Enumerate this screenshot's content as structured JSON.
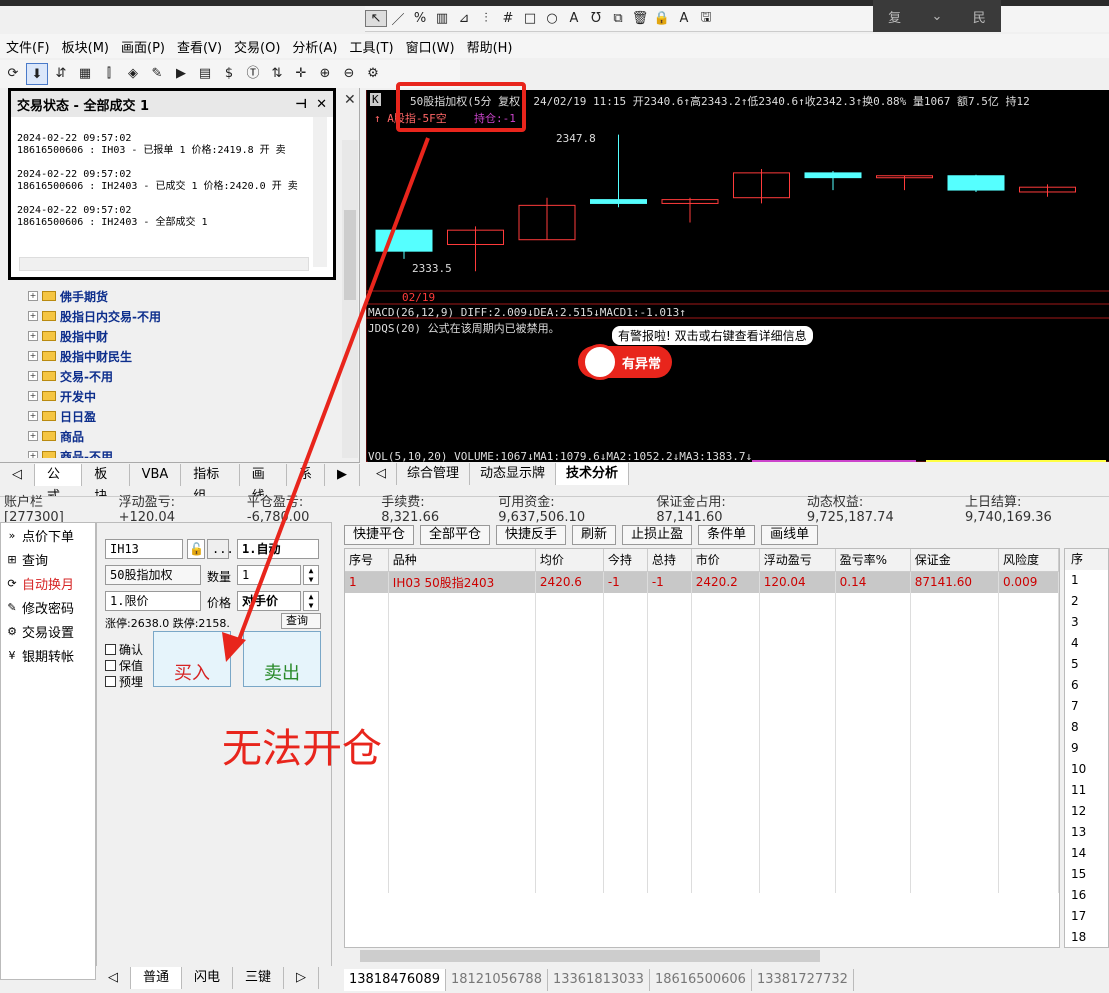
{
  "window": {
    "drawing_tools": [
      "↖",
      "／",
      "%",
      "▥",
      "⊿",
      "⫶",
      "#",
      "□",
      "○",
      "A",
      "Ʊ",
      "⧉",
      "🗑",
      "🔒",
      "A",
      "🖫"
    ],
    "dark_tab": [
      "复",
      "民"
    ]
  },
  "menu": [
    "文件(F)",
    "板块(M)",
    "画面(P)",
    "查看(V)",
    "交易(O)",
    "分析(A)",
    "工具(T)",
    "窗口(W)",
    "帮助(H)"
  ],
  "toolbar": [
    "⟳",
    "⬇",
    "⇵",
    "▦",
    "⫿",
    "◈",
    "✎",
    "▶",
    "▤",
    "$",
    "Ⓣ",
    "⇅",
    "✛",
    "⊕",
    "⊖",
    "⚙"
  ],
  "trade_popup": {
    "title": "交易状态 - 全部成交 1",
    "pin": "⊣",
    "close": "✕",
    "log": "\n2024-02-22 09:57:02\n18616500606 : IH03 - 已报单 1 价格:2419.8 开 卖\n\n2024-02-22 09:57:02\n18616500606 : IH2403 - 已成交 1 价格:2420.0 开 卖\n\n2024-02-22 09:57:02\n18616500606 : IH2403 - 全部成交 1"
  },
  "tree": [
    "佛手期货",
    "股指日内交易-不用",
    "股指中财",
    "股指中财民生",
    "交易-不用",
    "开发中",
    "日日盈",
    "商品",
    "商品-不用"
  ],
  "left_tabs": [
    "公式",
    "板块",
    "VBA",
    "指标组",
    "画线",
    "系"
  ],
  "chart": {
    "header_k": "K",
    "header": "50股指加权(5分 复权) 24/02/19 11:15 开2340.6↑高2343.2↑低2340.6↑收2342.3↑换0.88% 量1067 额7.5亿 持12",
    "subheader_a": "↑ A股指-5F空",
    "subheader_b": "持仓:-1",
    "high_label": "2347.8",
    "low_label": "2333.5",
    "date_label": "02/19",
    "macd": "MACD(26,12,9) DIFF:2.009↓DEA:2.515↓MACD1:-1.013↑",
    "jdqs": "JDQS(20)   公式在该周期内已被禁用。",
    "alert_text": "有警报啦! 双击或右键查看详细信息",
    "alert_badge": "有异常",
    "vol": "VOL(5,10,20) VOLUME:1067↓MA1:1079.6↓MA2:1052.2↓MA3:1383.7↓",
    "colors": {
      "up": "#ff3b3b",
      "down": "#55ffff",
      "bg": "#000000",
      "annot": "#e8251c"
    },
    "candles": [
      {
        "o": 2337.8,
        "h": 2337.8,
        "l": 2334.8,
        "c": 2335.6,
        "dir": "down"
      },
      {
        "o": 2336.3,
        "h": 2338.2,
        "l": 2333.5,
        "c": 2337.8,
        "dir": "up"
      },
      {
        "o": 2336.8,
        "h": 2341.2,
        "l": 2336.8,
        "c": 2340.4,
        "dir": "up"
      },
      {
        "o": 2341.0,
        "h": 2347.8,
        "l": 2340.2,
        "c": 2340.6,
        "dir": "down"
      },
      {
        "o": 2340.6,
        "h": 2341.2,
        "l": 2338.6,
        "c": 2341.0,
        "dir": "up"
      },
      {
        "o": 2341.2,
        "h": 2344.2,
        "l": 2340.6,
        "c": 2343.8,
        "dir": "up"
      },
      {
        "o": 2343.8,
        "h": 2344.0,
        "l": 2342.0,
        "c": 2343.3,
        "dir": "down"
      },
      {
        "o": 2343.5,
        "h": 2343.5,
        "l": 2342.0,
        "c": 2343.5,
        "dir": "up"
      },
      {
        "o": 2343.5,
        "h": 2343.6,
        "l": 2341.8,
        "c": 2342.0,
        "dir": "down"
      },
      {
        "o": 2341.8,
        "h": 2342.6,
        "l": 2341.3,
        "c": 2342.3,
        "dir": "up"
      }
    ],
    "ylim": [
      2333.0,
      2348.5
    ]
  },
  "chart_tabs": [
    "综合管理",
    "动态显示牌",
    "技术分析"
  ],
  "account_bar": [
    "账户栏 [277300]",
    "浮动盈亏: +120.04",
    "平仓盈亏: -6,780.00",
    "手续费: 8,321.66",
    "可用资金: 9,637,506.10",
    "保证金占用: 87,141.60",
    "动态权益: 9,725,187.74",
    "上日结算: 9,740,169.36"
  ],
  "order_menu": [
    {
      "icon": "»",
      "label": "点价下单"
    },
    {
      "icon": "⊞",
      "label": "查询"
    },
    {
      "icon": "⟳",
      "label": "自动换月"
    },
    {
      "icon": "✎",
      "label": "修改密码"
    },
    {
      "icon": "⚙",
      "label": "交易设置"
    },
    {
      "icon": "¥",
      "label": "银期转帐"
    }
  ],
  "order_form": {
    "code": "IH13",
    "lock": "🔓",
    "more": "...",
    "auto": "1.自动",
    "name": "50股指加权",
    "qty_label": "数量",
    "qty": "1",
    "price_type": "1.限价",
    "price_label": "价格",
    "price": "对手价",
    "query": "查询",
    "limits": "涨停:2638.0 跌停:2158.",
    "checks": [
      "确认",
      "保值",
      "预埋"
    ],
    "buy": "买入",
    "sell": "卖出"
  },
  "order_tabs": [
    "◁",
    "普通",
    "闪电",
    "三键",
    "▷"
  ],
  "pos_buttons": [
    "快捷平仓",
    "全部平仓",
    "快捷反手",
    "刷新",
    "止损止盈",
    "条件单",
    "画线单"
  ],
  "pos_table": {
    "headers": [
      "序号",
      "品种",
      "均价",
      "今持",
      "总持",
      "市价",
      "浮动盈亏",
      "盈亏率%",
      "保证金",
      "风险度"
    ],
    "rows": [
      [
        "1",
        "IH03 50股指2403",
        "2420.6",
        "-1",
        "-1",
        "2420.2",
        "120.04",
        "0.14",
        "87141.60",
        "0.009"
      ]
    ]
  },
  "right_list": {
    "header": "序",
    "rows": [
      "1",
      "2",
      "3",
      "4",
      "5",
      "6",
      "7",
      "8",
      "9",
      "10",
      "11",
      "12",
      "13",
      "14",
      "15",
      "16",
      "17",
      "18"
    ]
  },
  "account_tabs": [
    "13818476089",
    "18121056788",
    "13361813033",
    "18616500606",
    "13381727732"
  ],
  "annotation": "无法开仓"
}
